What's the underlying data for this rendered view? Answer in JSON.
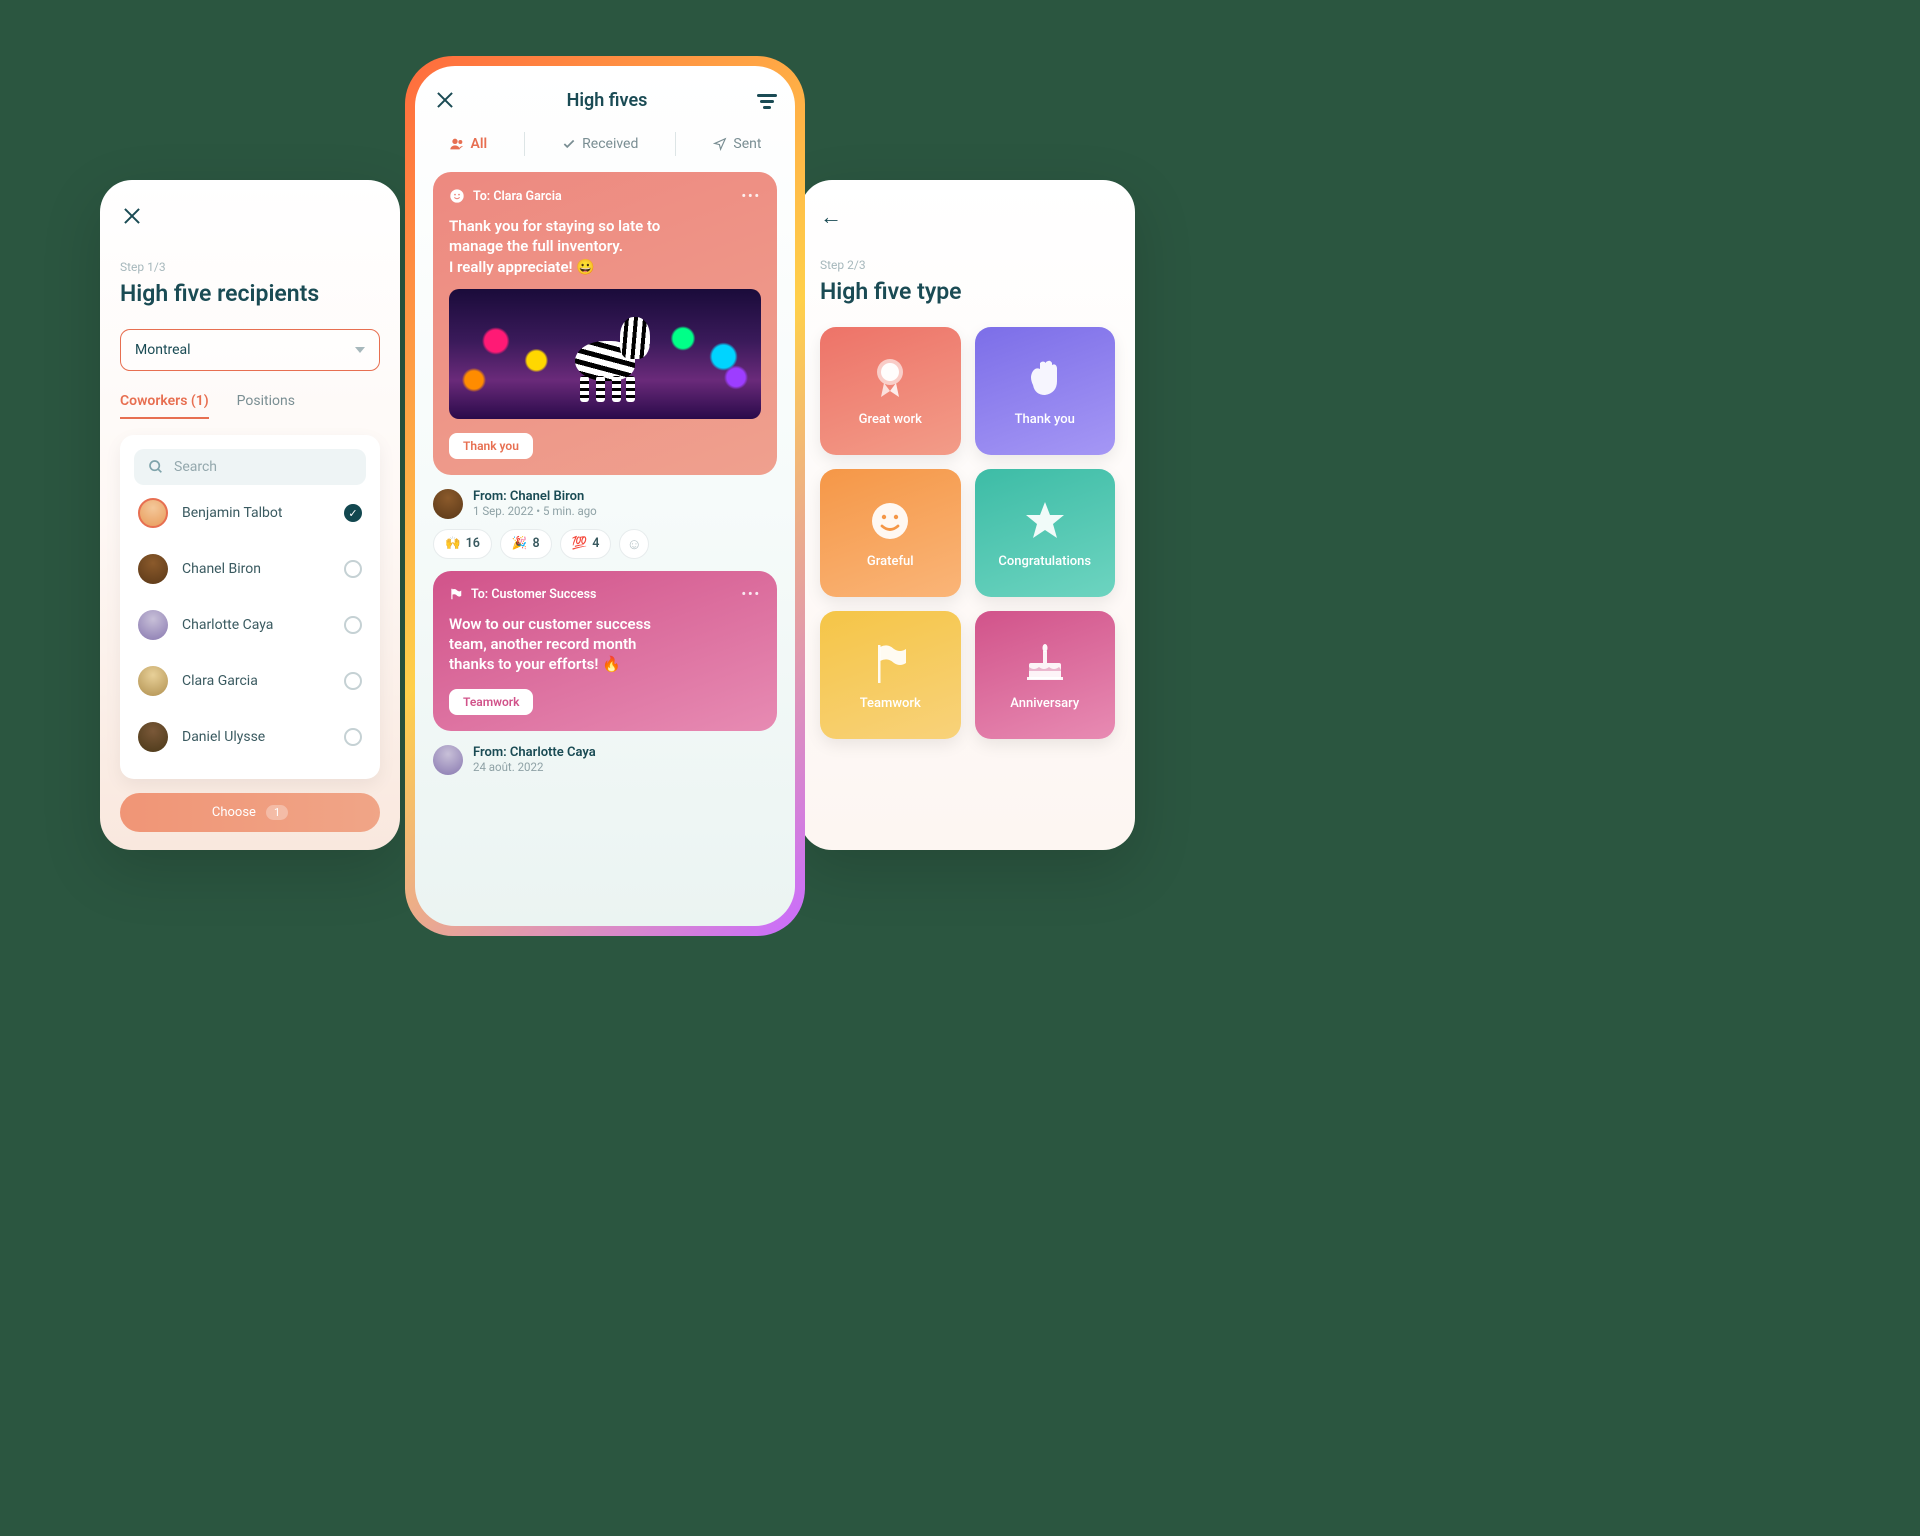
{
  "left": {
    "step": "Step 1/3",
    "title": "High five recipients",
    "dropdown": "Montreal",
    "tabs": {
      "coworkers": "Coworkers (1)",
      "positions": "Positions"
    },
    "search_placeholder": "Search",
    "coworkers": {
      "c1": "Benjamin Talbot",
      "c2": "Chanel Biron",
      "c3": "Charlotte Caya",
      "c4": "Clara Garcia",
      "c5": "Daniel Ulysse"
    },
    "choose_label": "Choose",
    "choose_count": "1"
  },
  "center": {
    "title": "High fives",
    "tabs": {
      "all": "All",
      "received": "Received",
      "sent": "Sent"
    },
    "card1": {
      "to": "To: Clara Garcia",
      "msg_l1": "Thank you for staying so late to",
      "msg_l2": "manage the full inventory.",
      "msg_l3": "I really appreciate! 😀",
      "tag": "Thank you",
      "from": "From: Chanel Biron",
      "date": "1 Sep. 2022  • 5 min. ago",
      "reactions": {
        "r1e": "🙌",
        "r1c": "16",
        "r2e": "🎉",
        "r2c": "8",
        "r3e": "💯",
        "r3c": "4"
      }
    },
    "card2": {
      "to": "To: Customer Success",
      "msg_l1": "Wow to our customer success",
      "msg_l2": "team, another record month",
      "msg_l3": "thanks to your efforts! 🔥",
      "tag": "Teamwork",
      "from": "From: Charlotte Caya",
      "date": "24 août. 2022"
    }
  },
  "right": {
    "step": "Step 2/3",
    "title": "High five type",
    "types": {
      "t1": "Great work",
      "t2": "Thank you",
      "t3": "Grateful",
      "t4": "Congratulations",
      "t5": "Teamwork",
      "t6": "Anniversary"
    }
  }
}
